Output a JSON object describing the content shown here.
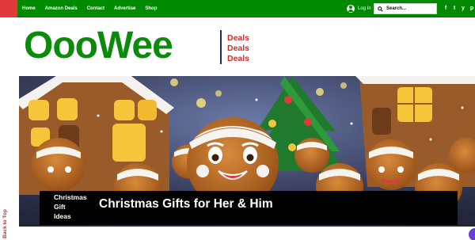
{
  "nav": {
    "items": [
      "Home",
      "Amazon Deals",
      "Contact",
      "Advertise",
      "Shop"
    ],
    "login_label": "Log In",
    "search_placeholder": "Search...",
    "social": [
      "f",
      "t",
      "y",
      "p"
    ]
  },
  "header": {
    "logo": "OooWee",
    "deals": [
      "Deals",
      "Deals",
      "Deals"
    ]
  },
  "hero": {
    "category_lines": [
      "Christmas",
      "Gift",
      "Ideas"
    ],
    "title": "Christmas Gifts for Her & Him"
  },
  "sidebar": {
    "back_to_top": "Back to Top"
  },
  "colors": {
    "brand_green": "#008a00",
    "logo_green": "#0c8a0c",
    "accent_red": "#d42a2a",
    "divider_navy": "#1a2a6e"
  },
  "icons": {
    "login": "user-circle-icon",
    "search": "search-icon",
    "social": [
      "facebook-icon",
      "twitter-icon",
      "youtube-icon",
      "pinterest-icon"
    ]
  }
}
